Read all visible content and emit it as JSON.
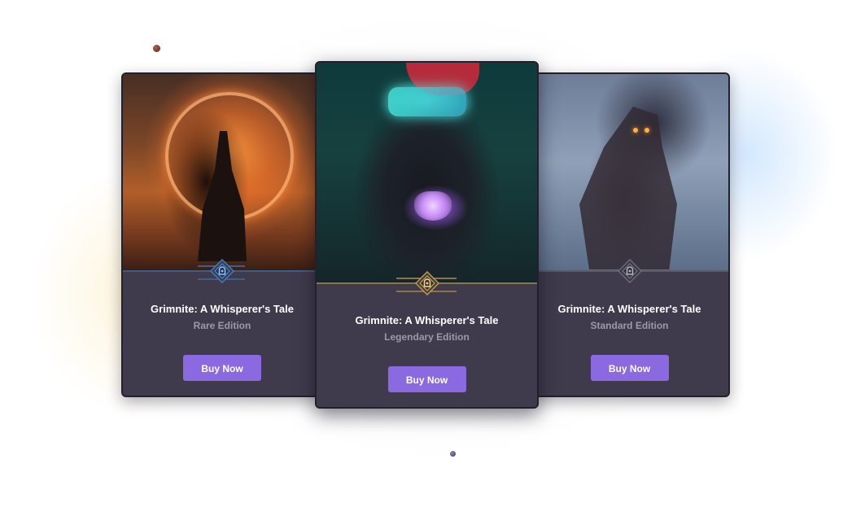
{
  "cards": [
    {
      "title": "Grimnite: A Whisperer's Tale",
      "edition": "Rare Edition",
      "button_label": "Buy Now",
      "accent_color": "#3e5d88",
      "badge_icon": "guardian-emblem-icon"
    },
    {
      "title": "Grimnite: A Whisperer's Tale",
      "edition": "Legendary Edition",
      "button_label": "Buy Now",
      "accent_color": "#8b7448",
      "badge_icon": "guardian-emblem-icon"
    },
    {
      "title": "Grimnite: A Whisperer's Tale",
      "edition": "Standard Edition",
      "button_label": "Buy Now",
      "accent_color": "#5b5a68",
      "badge_icon": "guardian-emblem-icon"
    }
  ],
  "colors": {
    "card_background": "#3f3b4c",
    "button": "#8b69e0",
    "edition_text": "#9d99a8"
  }
}
